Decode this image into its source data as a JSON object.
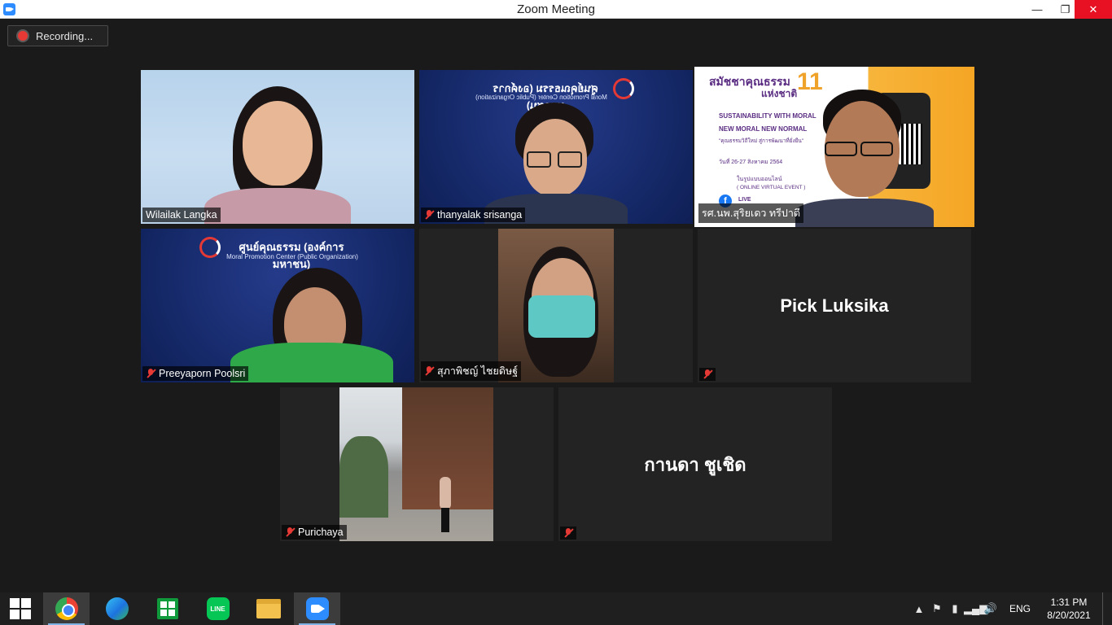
{
  "window": {
    "title": "Zoom Meeting",
    "controls": {
      "minimize": "—",
      "maximize": "❐",
      "close": "✕"
    }
  },
  "recording": {
    "label": "Recording..."
  },
  "participants": [
    {
      "name": "Wilailak Langka",
      "muted": false,
      "video": true
    },
    {
      "name": "thanyalak srisanga",
      "muted": true,
      "video": true,
      "logo_thai": "ศูนย์คุณธรรม (องค์การมหาชน)",
      "logo_en": "Moral Promotion Center (Public Organization)"
    },
    {
      "name": "รศ.นพ.สุริยเดว ทรีปาตี",
      "muted": false,
      "video": true,
      "active_speaker": true,
      "poster": {
        "title_thai": "สมัชชาคุณธรรม",
        "title_thai2": "แห่งชาติ",
        "number": "11",
        "line1": "SUSTAINABILITY WITH MORAL",
        "line2": "NEW MORAL NEW NORMAL",
        "tagline": "\"คุณธรรมวิถีใหม่ สู่การพัฒนาที่ยั่งยืน\"",
        "date": "วันที่ 26-27 สิงหาคม 2564",
        "format": "ในรูปแบบออนไลน์",
        "event": "( ONLINE VIRTUAL EVENT )",
        "live": "LIVE"
      }
    },
    {
      "name": "Preeyaporn Poolsri",
      "muted": true,
      "video": true,
      "logo_thai": "ศูนย์คุณธรรม (องค์การมหาชน)",
      "logo_en": "Moral Promotion Center (Public Organization)"
    },
    {
      "name": "สุภาพิชญ์ ไชยดิษฐ์",
      "muted": true,
      "video": true
    },
    {
      "name": "Pick Luksika",
      "muted": true,
      "video": false,
      "display_name": "Pick Luksika"
    },
    {
      "name": "Purichaya",
      "muted": true,
      "video": true
    },
    {
      "name": "",
      "muted": true,
      "video": false,
      "display_name": "กานดา ชูเชิด"
    }
  ],
  "taskbar": {
    "apps": [
      "chrome",
      "edge",
      "store",
      "line",
      "file-explorer",
      "zoom"
    ],
    "line_label": "LINE",
    "tray": {
      "language": "ENG",
      "time": "1:31 PM",
      "date": "8/20/2021",
      "overflow": "▲"
    }
  }
}
